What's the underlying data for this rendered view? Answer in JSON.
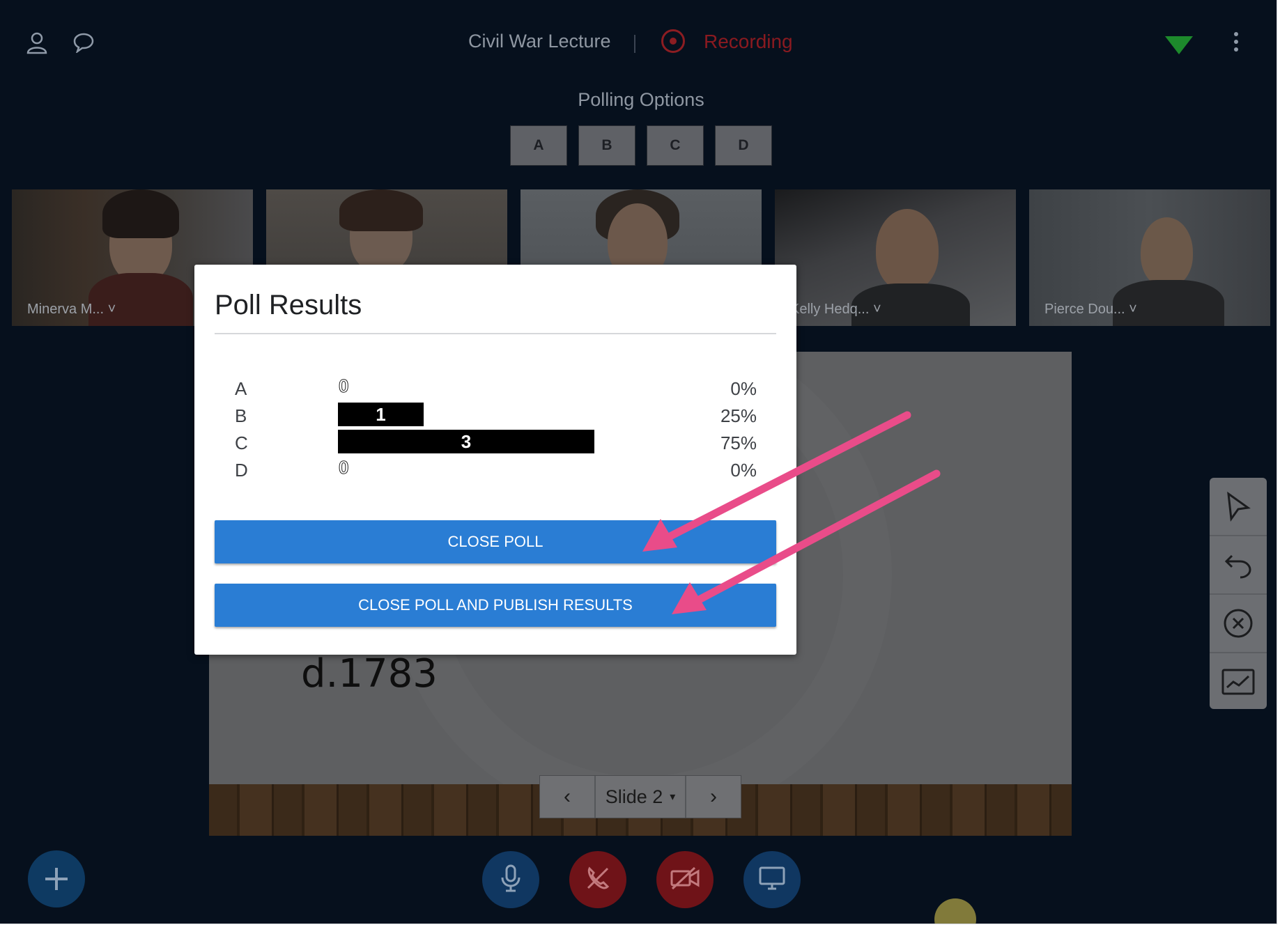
{
  "header": {
    "title": "Civil War Lecture",
    "recording_label": "Recording",
    "icons": [
      "user-icon",
      "chat-icon",
      "wifi-icon",
      "more-vert-icon"
    ]
  },
  "polling": {
    "title": "Polling Options",
    "options": [
      "A",
      "B",
      "C",
      "D"
    ]
  },
  "participants": [
    {
      "name": "Minerva M..."
    },
    {
      "name": ""
    },
    {
      "name": ""
    },
    {
      "name": "Kelly Hedq..."
    },
    {
      "name": "Pierce Dou..."
    }
  ],
  "caret": "˅",
  "slide": {
    "visible_text": "d.1783",
    "nav_label": "Slide 2",
    "nav_caret": "▾",
    "prev_icon": "‹",
    "next_icon": "›"
  },
  "poll_results": {
    "title": "Poll Results",
    "rows": [
      {
        "label": "A",
        "count": "0",
        "fraction": 0.0,
        "percent": "0%"
      },
      {
        "label": "B",
        "count": "1",
        "fraction": 0.25,
        "percent": "25%"
      },
      {
        "label": "C",
        "count": "3",
        "fraction": 0.75,
        "percent": "75%"
      },
      {
        "label": "D",
        "count": "0",
        "fraction": 0.0,
        "percent": "0%"
      }
    ],
    "close_label": "CLOSE POLL",
    "publish_label": "CLOSE POLL AND PUBLISH RESULTS"
  },
  "colors": {
    "background": "#06101d",
    "primary_button": "#2a7dd4",
    "recording": "#8a1a20",
    "annotation_arrow": "#e94c89",
    "wifi": "#1d8a2c"
  },
  "tools": [
    "pointer-icon",
    "undo-icon",
    "clear-icon",
    "whiteboard-icon"
  ],
  "controls": [
    "microphone-icon",
    "hangup-icon",
    "camera-off-icon",
    "screen-share-icon"
  ]
}
